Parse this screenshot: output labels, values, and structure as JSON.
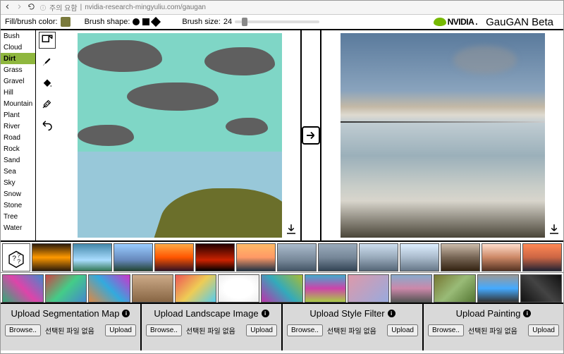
{
  "browser": {
    "security_hint": "주의 요함",
    "url": "nvidia-research-mingyuliu.com/gaugan"
  },
  "toolbar": {
    "fill_label": "Fill/brush color:",
    "shape_label": "Brush shape:",
    "size_label": "Brush size:",
    "size_value": "24",
    "logo_text": "NVIDIA",
    "app_title": "GauGAN Beta"
  },
  "categories": [
    "Bush",
    "Cloud",
    "Dirt",
    "Grass",
    "Gravel",
    "Hill",
    "Mountain",
    "Plant",
    "River",
    "Road",
    "Rock",
    "Sand",
    "Sea",
    "Sky",
    "Snow",
    "Stone",
    "Tree",
    "Water"
  ],
  "active_category_index": 2,
  "upload_panels": [
    {
      "title": "Upload Segmentation Map",
      "browse": "Browse..",
      "status": "선택된 파일 없음",
      "action": "Upload"
    },
    {
      "title": "Upload Landscape Image",
      "browse": "Browse..",
      "status": "선택된 파일 없음",
      "action": "Upload"
    },
    {
      "title": "Upload Style Filter",
      "browse": "Browse..",
      "status": "선택된 파일 없음",
      "action": "Upload"
    },
    {
      "title": "Upload Painting",
      "browse": "Browse..",
      "status": "선택된 파일 없음",
      "action": "Upload"
    }
  ],
  "style_thumbs_row1": 13,
  "style_thumbs_row2": 13
}
